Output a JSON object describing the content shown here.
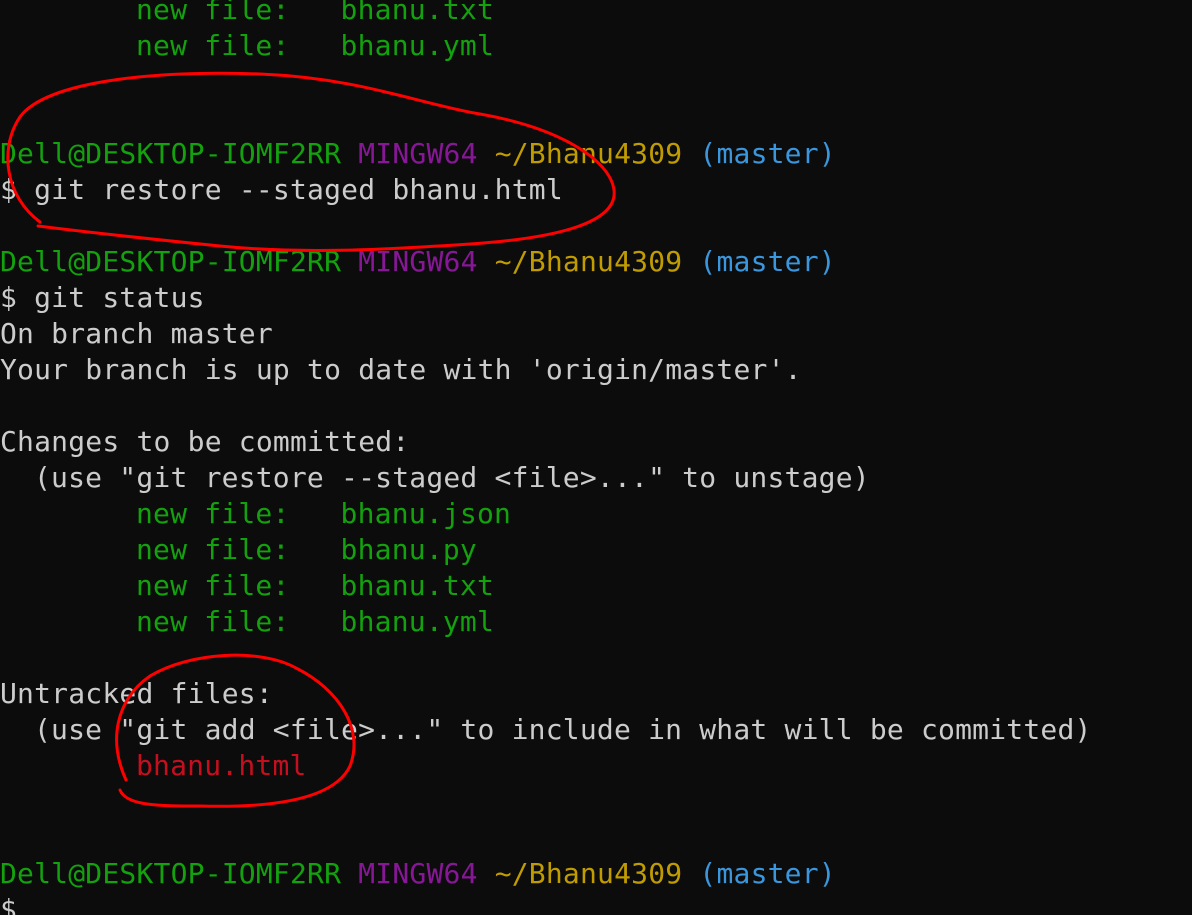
{
  "prompt": {
    "user_host": "Dell@DESKTOP-IOMF2RR",
    "env": "MINGW64",
    "path": "~/Bhanu4309",
    "branch": "(master)",
    "symbol": "$"
  },
  "colors": {
    "background": "#0c0c0c",
    "text": "#cccccc",
    "green": "#13a10e",
    "purple": "#881798",
    "yellow": "#c19c00",
    "blue": "#3a96dd",
    "red": "#c50f1f",
    "annotation": "#ff0000"
  },
  "previous_output": {
    "staged_files": [
      {
        "status": "new file:",
        "name": "bhanu.txt"
      },
      {
        "status": "new file:",
        "name": "bhanu.yml"
      }
    ]
  },
  "commands": {
    "restore": "git restore --staged bhanu.html",
    "status": "git status"
  },
  "status_output": {
    "branch_line": "On branch master",
    "up_to_date": "Your branch is up to date with 'origin/master'.",
    "staged_header": "Changes to be committed:",
    "staged_hint": "(use \"git restore --staged <file>...\" to unstage)",
    "staged_files": [
      {
        "status": "new file:",
        "name": "bhanu.json"
      },
      {
        "status": "new file:",
        "name": "bhanu.py"
      },
      {
        "status": "new file:",
        "name": "bhanu.txt"
      },
      {
        "status": "new file:",
        "name": "bhanu.yml"
      }
    ],
    "untracked_header": "Untracked files:",
    "untracked_hint": "(use \"git add <file>...\" to include in what will be committed)",
    "untracked_files": [
      "bhanu.html"
    ]
  },
  "annotations": [
    {
      "shape": "ellipse",
      "target": "restore-command"
    },
    {
      "shape": "ellipse",
      "target": "untracked-file"
    }
  ]
}
